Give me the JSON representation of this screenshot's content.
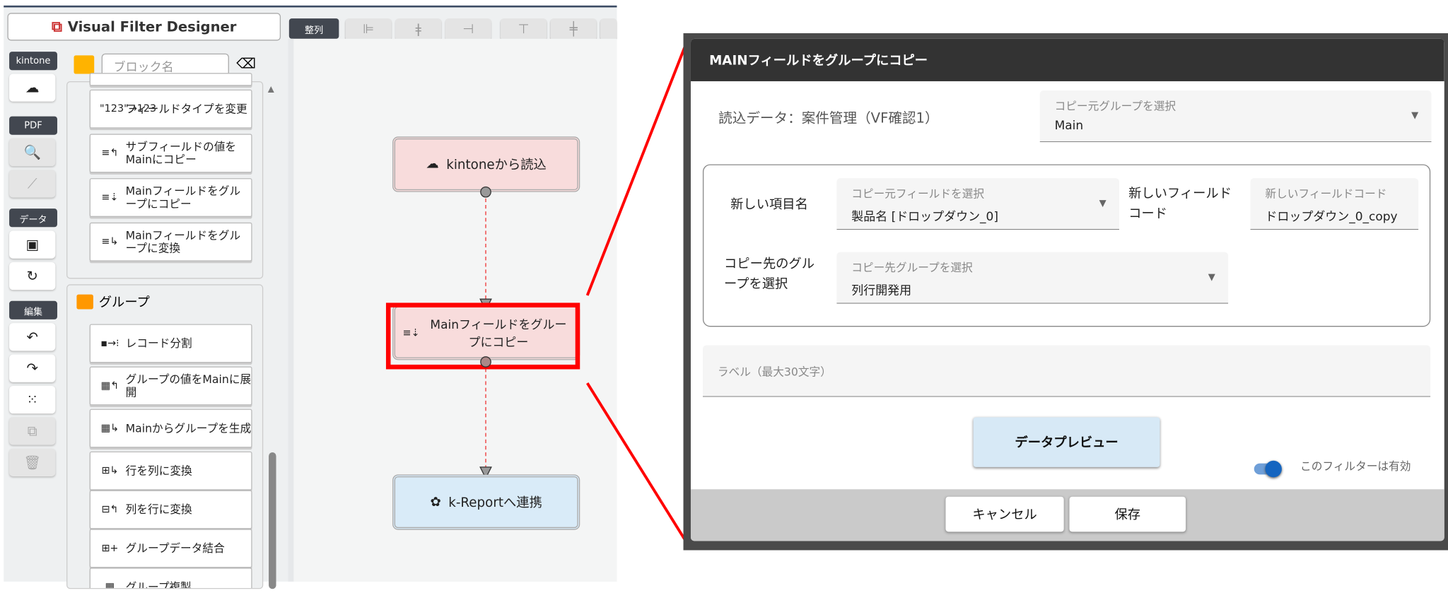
{
  "app": {
    "title": "Visual Filter Designer",
    "align_label": "整列",
    "align_buttons": [
      "align-left",
      "align-center-h",
      "align-right",
      "align-top",
      "align-center-v"
    ]
  },
  "rail": {
    "kintone": "kintone",
    "pdf": "PDF",
    "data": "データ",
    "edit": "編集"
  },
  "palette": {
    "search_placeholder": "ブロック名",
    "items_top": [
      {
        "icon": "\"123\"→123",
        "label": "フィールドタイプを変更"
      },
      {
        "icon": "≡↰",
        "label": "サブフィールドの値をMainにコピー"
      },
      {
        "icon": "≡⇣",
        "label": "Mainフィールドをグループにコピー"
      },
      {
        "icon": "≡↳",
        "label": "Mainフィールドをグループに変換"
      }
    ],
    "group_title": "グループ",
    "group_items": [
      {
        "icon": "▪→⁝",
        "label": "レコード分割"
      },
      {
        "icon": "▦↰",
        "label": "グループの値をMainに展開"
      },
      {
        "icon": "▦↳",
        "label": "Mainからグループを生成"
      },
      {
        "icon": "⊞↳",
        "label": "行を列に変換"
      },
      {
        "icon": "⊟↰",
        "label": "列を行に変換"
      },
      {
        "icon": "⊞+",
        "label": "グループデータ結合"
      },
      {
        "icon": "▦",
        "label": "グループ複製"
      }
    ]
  },
  "canvas": {
    "nodes": [
      {
        "label": "kintoneから読込"
      },
      {
        "label": "Mainフィールドをグループにコピー"
      },
      {
        "label": "k-Reportへ連携"
      }
    ]
  },
  "dialog": {
    "title": "MAINフィールドをグループにコピー",
    "read_data": "読込データ：案件管理（VF確認1）",
    "source_group": {
      "label": "コピー元グループを選択",
      "value": "Main"
    },
    "new_item_label": "新しい項目名",
    "source_field": {
      "label": "コピー元フィールドを選択",
      "value": "製品名 [ドロップダウン_0]"
    },
    "new_code_label": "新しいフィールドコード",
    "new_code": {
      "label": "新しいフィールドコード",
      "value": "ドロップダウン_0_copy"
    },
    "dest_label": "コピー先のグループを選択",
    "dest_group": {
      "label": "コピー先グループを選択",
      "value": "列行開発用"
    },
    "label_field": {
      "placeholder": "ラベル（最大30文字）"
    },
    "preview": "データプレビュー",
    "enabled_label": "このフィルターは有効",
    "enabled": true,
    "cancel": "キャンセル",
    "save": "保存"
  },
  "colors": {
    "highlight": "#ff0000",
    "node_pink": "#f8dcdc",
    "node_blue": "#d9ebf8",
    "toggle": "#1565c0"
  }
}
